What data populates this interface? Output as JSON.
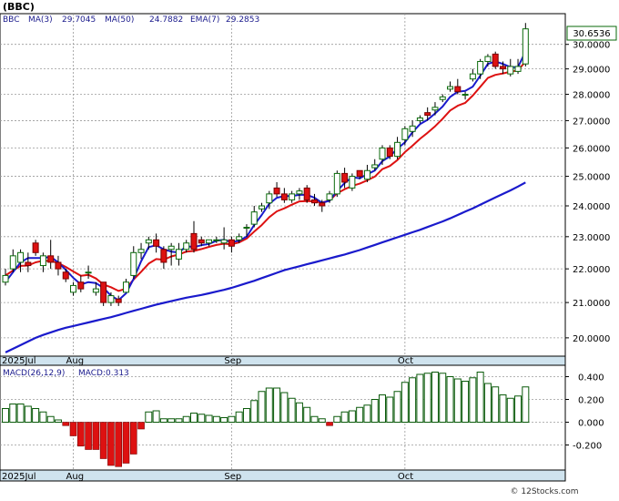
{
  "chart_data": [
    {
      "type": "candlestick",
      "symbol_label": "(BBC)",
      "legend": [
        {
          "text": "BBC",
          "color": "#1a1a8c"
        },
        {
          "text": "MA(3)",
          "color": "#1a1a8c"
        },
        {
          "text": "29.7045",
          "color": "#1a1a8c"
        },
        {
          "text": "MA(50)",
          "color": "#1a1a8c"
        },
        {
          "text": "24.7882",
          "color": "#1a1a8c"
        },
        {
          "text": "EMA(7)",
          "color": "#1a1a8c"
        },
        {
          "text": "29.2853",
          "color": "#1a1a8c"
        }
      ],
      "last_price_label": "30.6536",
      "y_ticks": [
        20.0,
        21.0,
        22.0,
        23.0,
        24.0,
        25.0,
        26.0,
        27.0,
        28.0,
        29.0,
        30.0
      ],
      "y_tick_labels": [
        "20.0000",
        "21.0000",
        "22.0000",
        "23.0000",
        "24.0000",
        "25.0000",
        "26.0000",
        "27.0000",
        "28.0000",
        "29.0000",
        "30.0000"
      ],
      "ylim": [
        19.5,
        31.3
      ],
      "log_scale": true,
      "x_labels": [
        {
          "text": "2025Jul",
          "index": 0
        },
        {
          "text": "Aug",
          "index": 9
        },
        {
          "text": "Sep",
          "index": 30
        },
        {
          "text": "Oct",
          "index": 53
        }
      ],
      "colors": {
        "up_fill": "#ffffff",
        "up_edge": "#0a6a0a",
        "down_fill": "#dd1111",
        "down_edge": "#7a0000",
        "ma3": "#1a1acc",
        "ema7": "#dd1111",
        "ma50": "#1a1acc",
        "grid": "#9a9a9a",
        "band": "#cfe3ee"
      },
      "ohlc": [
        [
          21.6,
          22.0,
          21.5,
          21.8
        ],
        [
          22.0,
          22.6,
          21.9,
          22.4
        ],
        [
          22.2,
          22.6,
          21.9,
          22.5
        ],
        [
          22.2,
          22.5,
          21.9,
          22.1
        ],
        [
          22.8,
          22.9,
          22.4,
          22.5
        ],
        [
          22.1,
          22.5,
          21.9,
          22.4
        ],
        [
          22.4,
          22.9,
          22.0,
          22.2
        ],
        [
          22.2,
          22.4,
          21.8,
          22.0
        ],
        [
          21.9,
          22.0,
          21.6,
          21.7
        ],
        [
          21.3,
          21.6,
          21.2,
          21.5
        ],
        [
          21.6,
          21.8,
          21.3,
          21.4
        ],
        [
          21.9,
          22.1,
          21.7,
          21.9
        ],
        [
          21.3,
          21.6,
          21.2,
          21.4
        ],
        [
          21.6,
          21.6,
          20.9,
          21.0
        ],
        [
          21.0,
          21.3,
          20.9,
          21.2
        ],
        [
          21.1,
          21.2,
          20.9,
          21.0
        ],
        [
          21.3,
          21.7,
          21.3,
          21.6
        ],
        [
          21.8,
          22.7,
          21.7,
          22.5
        ],
        [
          22.5,
          22.8,
          22.3,
          22.6
        ],
        [
          22.8,
          23.0,
          22.6,
          22.9
        ],
        [
          22.9,
          23.1,
          22.5,
          22.7
        ],
        [
          22.6,
          22.7,
          22.0,
          22.2
        ],
        [
          22.6,
          22.8,
          22.1,
          22.7
        ],
        [
          22.3,
          22.8,
          22.1,
          22.6
        ],
        [
          22.6,
          22.9,
          22.5,
          22.8
        ],
        [
          23.1,
          23.5,
          22.5,
          22.6
        ],
        [
          22.9,
          23.0,
          22.7,
          22.8
        ],
        [
          22.8,
          22.9,
          22.7,
          22.9
        ],
        [
          22.9,
          23.0,
          22.8,
          22.9
        ],
        [
          22.8,
          23.3,
          22.6,
          22.9
        ],
        [
          22.9,
          23.0,
          22.5,
          22.7
        ],
        [
          22.9,
          23.1,
          22.8,
          23.0
        ],
        [
          23.3,
          23.4,
          23.0,
          23.3
        ],
        [
          23.4,
          24.0,
          23.3,
          23.8
        ],
        [
          23.9,
          24.1,
          23.8,
          24.0
        ],
        [
          24.1,
          24.5,
          23.9,
          24.4
        ],
        [
          24.6,
          24.8,
          24.3,
          24.4
        ],
        [
          24.4,
          24.6,
          24.1,
          24.2
        ],
        [
          24.2,
          24.5,
          24.1,
          24.4
        ],
        [
          24.4,
          24.6,
          24.2,
          24.5
        ],
        [
          24.6,
          24.7,
          24.1,
          24.2
        ],
        [
          24.2,
          24.4,
          24.0,
          24.1
        ],
        [
          24.1,
          24.2,
          23.8,
          24.0
        ],
        [
          24.2,
          24.5,
          24.1,
          24.4
        ],
        [
          24.4,
          25.2,
          24.3,
          25.1
        ],
        [
          25.1,
          25.3,
          24.6,
          24.8
        ],
        [
          24.6,
          25.1,
          24.5,
          25.0
        ],
        [
          25.2,
          25.2,
          24.9,
          25.0
        ],
        [
          24.9,
          25.4,
          24.8,
          25.2
        ],
        [
          25.3,
          25.6,
          25.2,
          25.4
        ],
        [
          25.6,
          26.1,
          25.4,
          26.0
        ],
        [
          26.0,
          26.1,
          25.6,
          25.7
        ],
        [
          25.7,
          26.4,
          25.6,
          26.2
        ],
        [
          26.3,
          26.8,
          26.1,
          26.7
        ],
        [
          26.6,
          27.0,
          26.4,
          26.8
        ],
        [
          27.0,
          27.2,
          26.9,
          27.1
        ],
        [
          27.3,
          27.5,
          27.0,
          27.2
        ],
        [
          27.4,
          27.7,
          27.2,
          27.5
        ],
        [
          27.8,
          28.0,
          27.7,
          27.9
        ],
        [
          28.2,
          28.5,
          28.1,
          28.3
        ],
        [
          28.3,
          28.6,
          28.0,
          28.1
        ],
        [
          28.0,
          28.1,
          27.8,
          28.0
        ],
        [
          28.6,
          29.0,
          28.5,
          28.8
        ],
        [
          28.8,
          29.4,
          28.6,
          29.3
        ],
        [
          29.3,
          29.6,
          29.1,
          29.5
        ],
        [
          29.6,
          29.7,
          29.0,
          29.1
        ],
        [
          29.1,
          29.3,
          28.8,
          29.0
        ],
        [
          28.8,
          29.4,
          28.7,
          29.1
        ],
        [
          28.9,
          29.4,
          28.8,
          29.1
        ],
        [
          29.2,
          30.9,
          29.1,
          30.65
        ]
      ],
      "ma3": [
        21.6,
        21.9,
        22.2,
        22.33,
        22.33,
        22.33,
        22.37,
        22.2,
        21.97,
        21.73,
        21.53,
        21.6,
        21.57,
        21.43,
        21.2,
        21.07,
        21.27,
        21.7,
        22.23,
        22.67,
        22.73,
        22.6,
        22.53,
        22.5,
        22.7,
        22.67,
        22.73,
        22.77,
        22.87,
        22.9,
        22.83,
        22.87,
        23.0,
        23.37,
        23.7,
        24.07,
        24.27,
        24.33,
        24.33,
        24.37,
        24.37,
        24.27,
        24.1,
        24.17,
        24.5,
        24.77,
        24.97,
        24.93,
        25.07,
        25.2,
        25.53,
        25.7,
        25.97,
        26.2,
        26.57,
        26.87,
        27.03,
        27.27,
        27.53,
        27.9,
        28.1,
        28.13,
        28.3,
        28.73,
        29.2,
        29.3,
        29.2,
        29.07,
        29.07,
        29.7
      ],
      "ema7": [
        21.8,
        21.95,
        22.09,
        22.1,
        22.2,
        22.25,
        22.24,
        22.18,
        22.06,
        21.92,
        21.79,
        21.82,
        21.71,
        21.53,
        21.45,
        21.34,
        21.41,
        21.68,
        21.91,
        22.16,
        22.3,
        22.28,
        22.38,
        22.44,
        22.53,
        22.55,
        22.61,
        22.68,
        22.74,
        22.78,
        22.76,
        22.82,
        22.94,
        23.16,
        23.37,
        23.63,
        23.82,
        23.92,
        24.04,
        24.15,
        24.16,
        24.15,
        24.11,
        24.18,
        24.42,
        24.56,
        24.67,
        24.75,
        24.86,
        24.99,
        25.25,
        25.36,
        25.57,
        25.85,
        26.08,
        26.33,
        26.55,
        26.79,
        27.07,
        27.38,
        27.56,
        27.67,
        27.95,
        28.29,
        28.64,
        28.76,
        28.82,
        28.89,
        28.94,
        29.3
      ],
      "ma50": [
        19.6,
        19.7,
        19.8,
        19.9,
        20.0,
        20.08,
        20.15,
        20.22,
        20.28,
        20.33,
        20.38,
        20.43,
        20.48,
        20.53,
        20.58,
        20.64,
        20.7,
        20.76,
        20.82,
        20.88,
        20.94,
        20.99,
        21.04,
        21.09,
        21.14,
        21.18,
        21.22,
        21.27,
        21.32,
        21.37,
        21.43,
        21.5,
        21.57,
        21.64,
        21.72,
        21.8,
        21.88,
        21.96,
        22.02,
        22.08,
        22.14,
        22.2,
        22.26,
        22.32,
        22.38,
        22.44,
        22.51,
        22.58,
        22.66,
        22.74,
        22.82,
        22.9,
        22.98,
        23.06,
        23.14,
        23.22,
        23.31,
        23.4,
        23.49,
        23.59,
        23.7,
        23.81,
        23.92,
        24.04,
        24.16,
        24.28,
        24.4,
        24.52,
        24.65,
        24.79
      ]
    },
    {
      "type": "bar",
      "title": "MACD(26,12,9)",
      "value_label": "MACD:0.313",
      "y_ticks": [
        -0.2,
        0.0,
        0.2,
        0.4
      ],
      "y_tick_labels": [
        "-0.200",
        "0.000",
        "0.200",
        "0.400"
      ],
      "ylim": [
        -0.42,
        0.5
      ],
      "x_labels": [
        {
          "text": "2025Jul",
          "index": 0
        },
        {
          "text": "Aug",
          "index": 9
        },
        {
          "text": "Sep",
          "index": 30
        },
        {
          "text": "Oct",
          "index": 53
        }
      ],
      "colors": {
        "positive_edge": "#0a5a0a",
        "negative_fill": "#dd1111",
        "grid": "#9a9a9a"
      },
      "values": [
        0.12,
        0.16,
        0.16,
        0.14,
        0.12,
        0.09,
        0.05,
        0.02,
        -0.03,
        -0.12,
        -0.21,
        -0.24,
        -0.24,
        -0.32,
        -0.38,
        -0.39,
        -0.36,
        -0.28,
        -0.06,
        0.09,
        0.1,
        0.03,
        0.03,
        0.03,
        0.05,
        0.08,
        0.07,
        0.06,
        0.05,
        0.04,
        0.05,
        0.09,
        0.12,
        0.19,
        0.27,
        0.3,
        0.3,
        0.26,
        0.21,
        0.17,
        0.13,
        0.05,
        0.03,
        -0.03,
        0.05,
        0.09,
        0.1,
        0.13,
        0.15,
        0.2,
        0.24,
        0.22,
        0.27,
        0.35,
        0.39,
        0.42,
        0.43,
        0.44,
        0.43,
        0.4,
        0.38,
        0.36,
        0.39,
        0.44,
        0.34,
        0.31,
        0.24,
        0.21,
        0.23,
        0.31
      ]
    }
  ],
  "watermark": "© 12Stocks.com"
}
